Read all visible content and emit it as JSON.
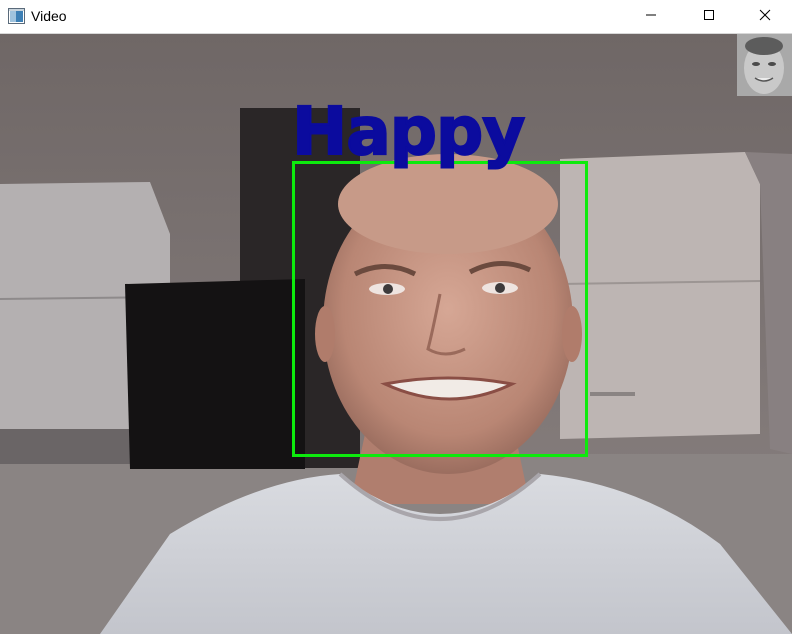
{
  "window": {
    "title": "Video",
    "icons": {
      "app": "app-window-icon",
      "minimize": "minimize-icon",
      "maximize": "maximize-icon",
      "close": "close-icon"
    }
  },
  "video": {
    "emotion_label": "Happy",
    "detection_box_color": "#0dea0d",
    "label_color": "#0b0b9e"
  }
}
